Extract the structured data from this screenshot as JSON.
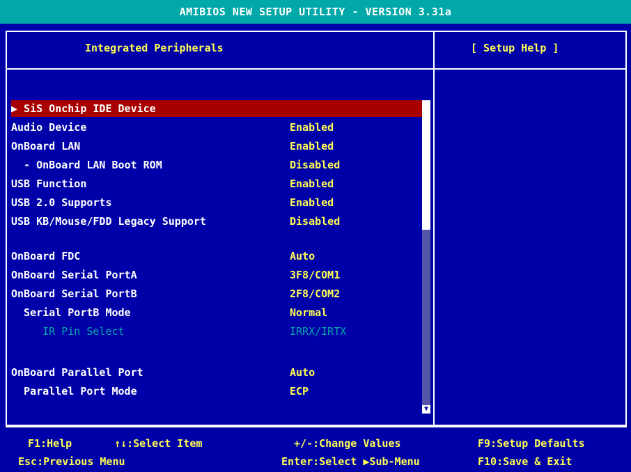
{
  "window": {
    "title": "AMIBIOS NEW SETUP UTILITY - VERSION 3.31a"
  },
  "panels": {
    "left_title": "Integrated Peripherals",
    "right_title": "[  Setup Help  ]"
  },
  "items": [
    {
      "label": "▶ SiS Onchip IDE Device",
      "value": ""
    },
    {
      "label": "Audio Device",
      "value": "Enabled"
    },
    {
      "label": "OnBoard LAN",
      "value": "Enabled"
    },
    {
      "label": "  - OnBoard LAN Boot ROM",
      "value": "Disabled"
    },
    {
      "label": "USB Function",
      "value": "Enabled"
    },
    {
      "label": "USB 2.0 Supports",
      "value": "Enabled"
    },
    {
      "label": "USB KB/Mouse/FDD Legacy Support",
      "value": "Disabled"
    },
    {
      "label": "OnBoard FDC",
      "value": "Auto"
    },
    {
      "label": "OnBoard Serial PortA",
      "value": "3F8/COM1"
    },
    {
      "label": "OnBoard Serial PortB",
      "value": "2F8/COM2"
    },
    {
      "label": "  Serial PortB Mode",
      "value": "Normal"
    },
    {
      "label": "     IR Pin Select",
      "value": "IRRX/IRTX"
    },
    {
      "label": "OnBoard Parallel Port",
      "value": "Auto"
    },
    {
      "label": "  Parallel Port Mode",
      "value": "ECP"
    }
  ],
  "scrollbar": {
    "arrow": "▼"
  },
  "footer": {
    "help": "F1:Help",
    "select_item": "↑↓:Select Item",
    "change_values": "+/-:Change Values",
    "setup_defaults": "F9:Setup Defaults",
    "previous_menu": "Esc:Previous Menu",
    "sub_menu": "Enter:Select ▶Sub-Menu",
    "save_exit": "F10:Save & Exit"
  },
  "colors": {
    "background": "#0000a8",
    "title_bar": "#00a8a8",
    "highlight": "#a80000",
    "value_text": "#ffff54",
    "disabled_text": "#00a8a8"
  }
}
